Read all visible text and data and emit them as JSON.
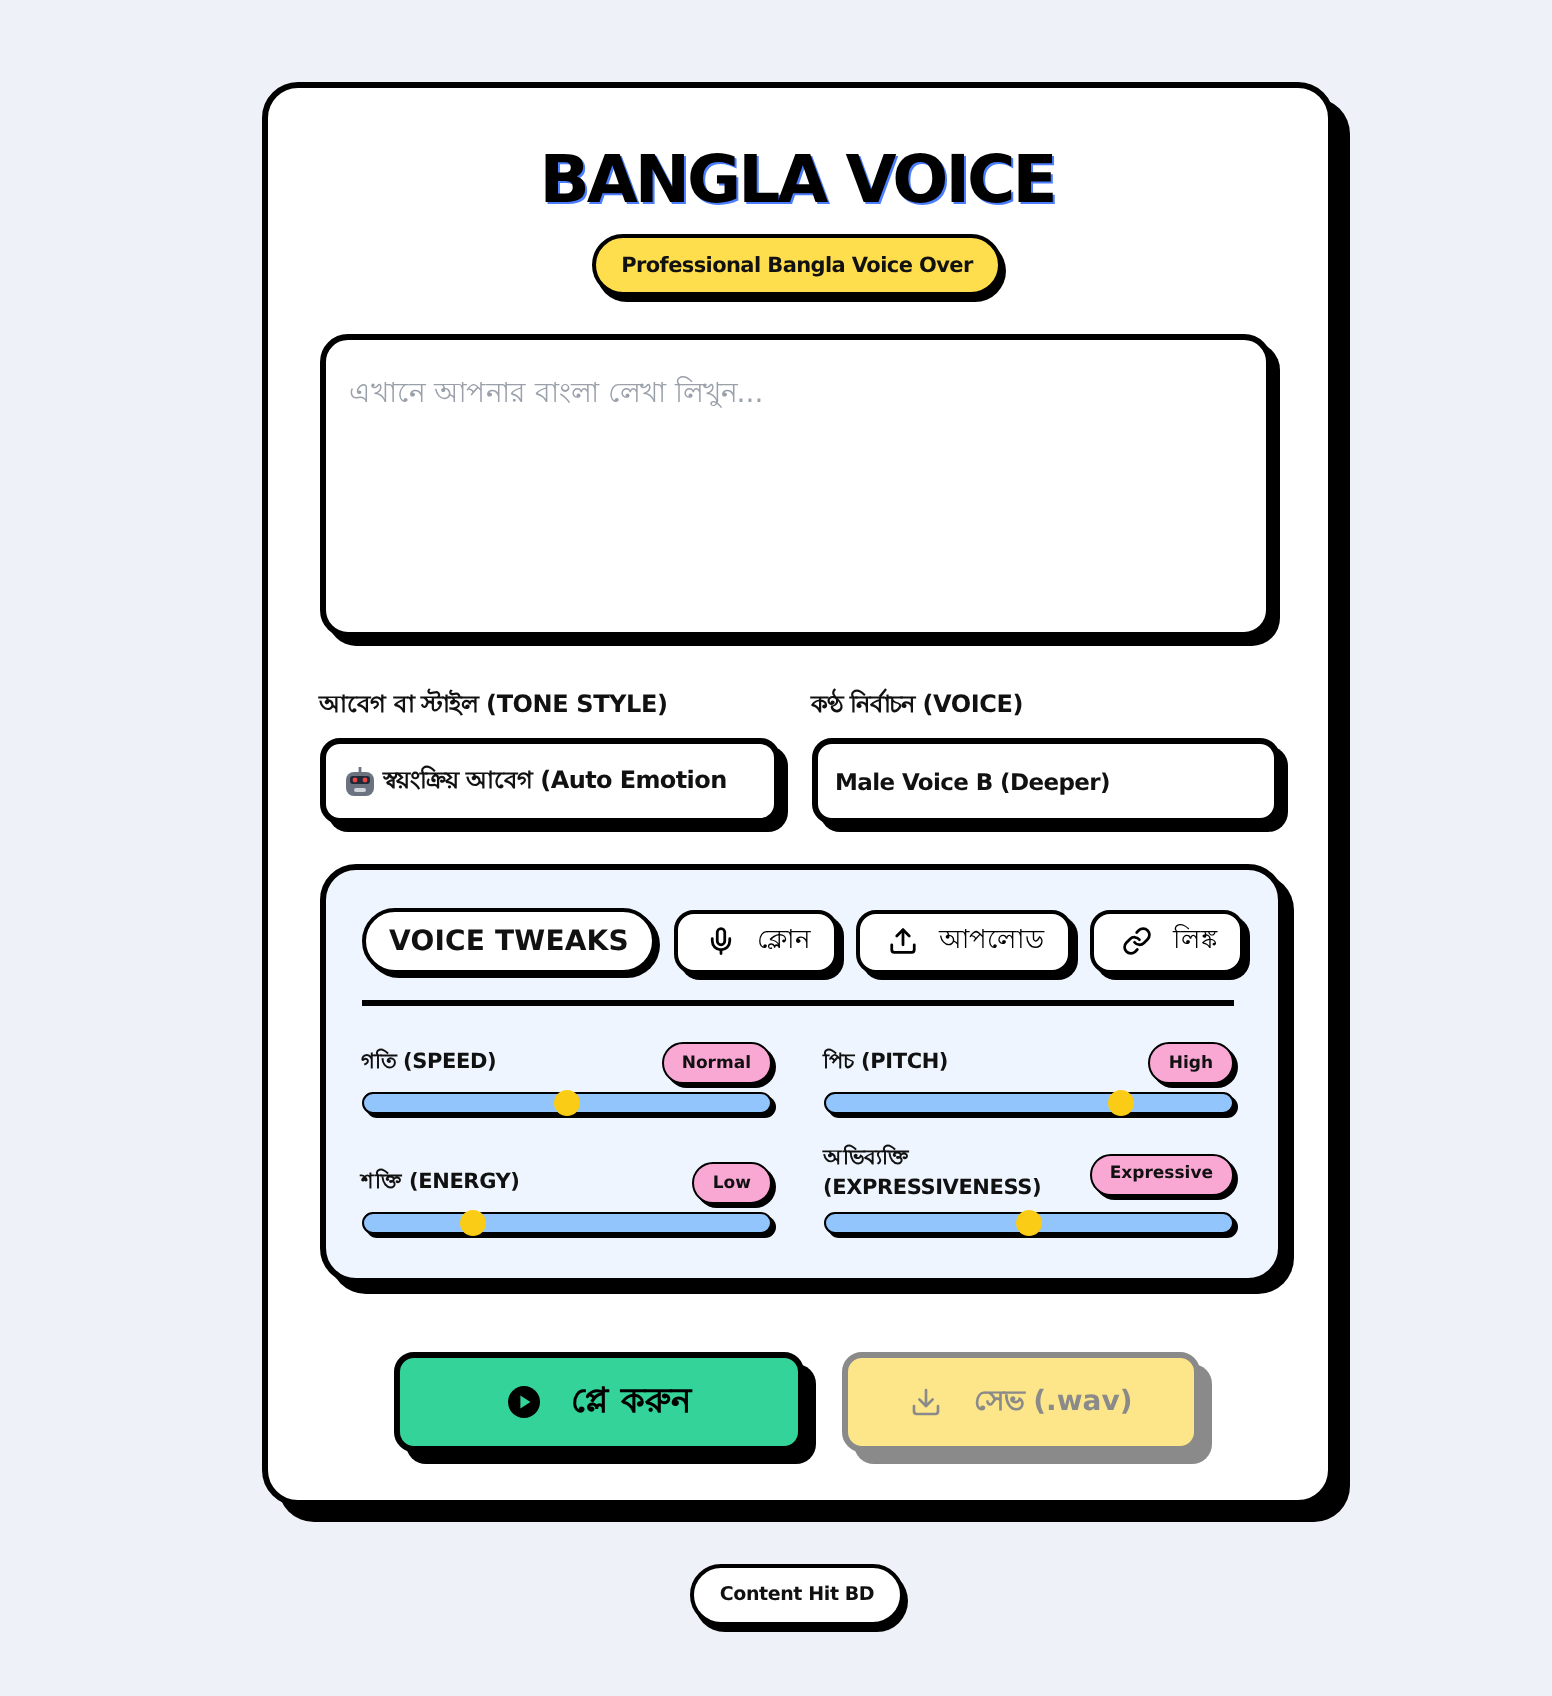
{
  "header": {
    "title": "BANGLA VOICE",
    "subtitle": "Professional Bangla Voice Over"
  },
  "text_input": {
    "placeholder": "এখানে আপনার বাংলা লেখা লিখুন..."
  },
  "selects": [
    {
      "label": "আবেগ বা স্টাইল (TONE STYLE)",
      "value": "স্বয়ংক্রিয় আবেগ (Auto Emotion",
      "kind": "robot"
    },
    {
      "label": "কণ্ঠ নির্বাচন (VOICE)",
      "value": "Male Voice B (Deeper)",
      "kind": "plain"
    }
  ],
  "tweaks": {
    "title": "VOICE TWEAKS",
    "tools": [
      {
        "label": "ক্লোন",
        "kind": "clone"
      },
      {
        "label": "আপলোড",
        "kind": "upload"
      },
      {
        "label": "লিঙ্ক",
        "kind": "link"
      }
    ],
    "sliders": [
      {
        "label": "গতি (SPEED)",
        "reading": "Normal",
        "level": 0.5
      },
      {
        "label": "শক্তি (ENERGY)",
        "reading": "Low",
        "level": 0.27
      },
      {
        "label": "পিচ (PITCH)",
        "reading": "High",
        "level": 0.73
      },
      {
        "label": "অভিব্যক্তি (EXPRESSIVENESS)",
        "reading": "Expressive",
        "level": 0.5
      }
    ]
  },
  "actions": [
    {
      "label": "প্লে করুন",
      "kind": "play",
      "disabled": false
    },
    {
      "label": "সেভ (.wav)",
      "kind": "save",
      "disabled": true
    }
  ],
  "footer": {
    "credit": "Content Hit BD"
  }
}
